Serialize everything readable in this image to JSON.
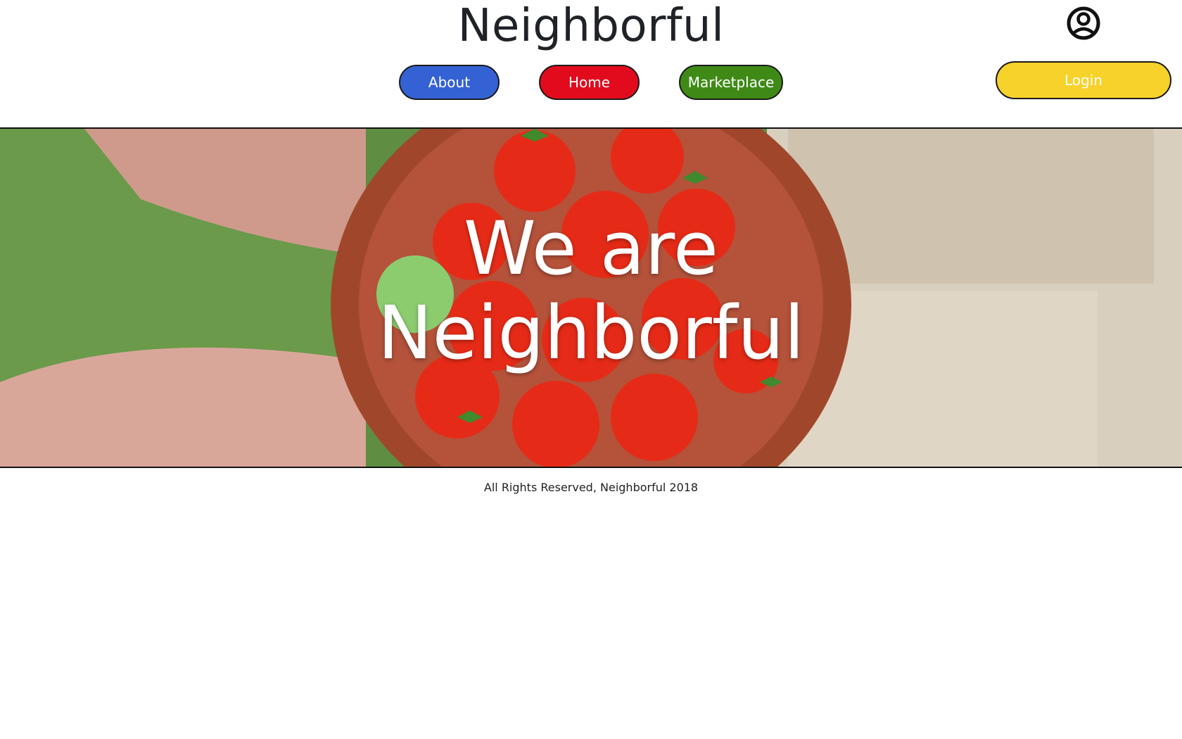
{
  "header": {
    "site_title": "Neighborful",
    "nav": {
      "about": "About",
      "home": "Home",
      "marketplace": "Marketplace"
    },
    "login_label": "Login"
  },
  "hero": {
    "line1": "We are",
    "line2": "Neighborful"
  },
  "footer": {
    "text": "All Rights Reserved, Neighborful 2018"
  },
  "colors": {
    "about": "#3462d4",
    "home": "#e20b1d",
    "marketplace": "#3f8a17",
    "login": "#f7d22a"
  },
  "icons": {
    "profile": "user-circle-icon"
  }
}
